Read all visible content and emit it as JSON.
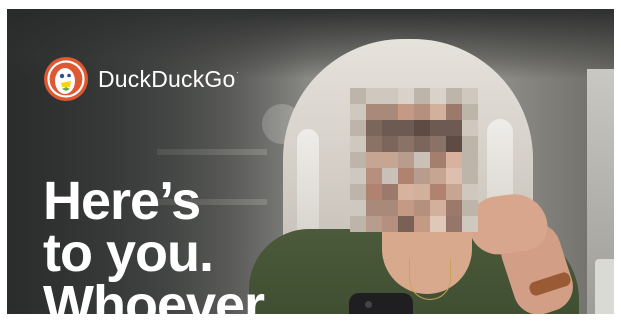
{
  "brand": {
    "name": "DuckDuckGo",
    "trademark": ".",
    "icon": "duckduckgo-logo-icon",
    "colors": {
      "logo_red": "#de5833",
      "logo_white": "#ffffff",
      "beak_orange": "#fdd20a",
      "bow_tie_green": "#67ac46"
    }
  },
  "headline": {
    "line1": "Here’s",
    "line2": "to you.",
    "line3": "Whoever"
  },
  "photo": {
    "subject": "woman-with-gray-hair-face-pixelated",
    "colors": {
      "shirt": "#4b5a3a",
      "hair": "#dcd7cf",
      "background": "#7a7a75"
    }
  }
}
